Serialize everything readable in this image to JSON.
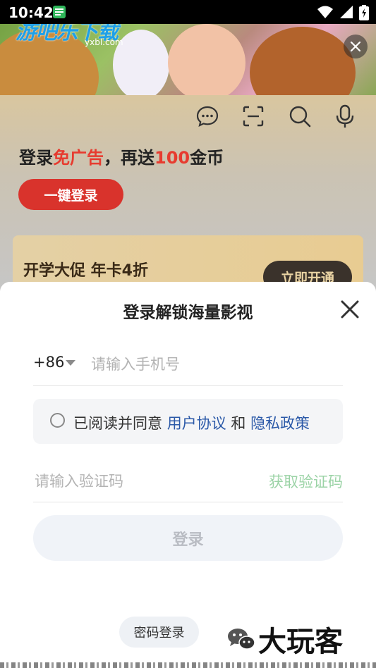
{
  "status_bar": {
    "time": "10:42",
    "icons": [
      "notification-icon",
      "wifi-icon",
      "signal-icon",
      "battery-icon"
    ]
  },
  "banner": {
    "watermark": "游吧乐下载",
    "watermark_sub": "yxbl.com",
    "close_icon": "close-icon"
  },
  "header_icons": [
    "message-icon",
    "scan-icon",
    "search-icon",
    "mic-icon"
  ],
  "promo": {
    "prefix": "登录",
    "highlight1": "免广告",
    "middle": "，再送",
    "highlight2": "100",
    "suffix": "金币",
    "login_button": "一键登录",
    "highlight_color": "#e73b2f"
  },
  "vip": {
    "title": "开学大促 年卡4折",
    "button": "立即开通"
  },
  "sheet": {
    "title": "登录解锁海量影视",
    "country_code": "+86",
    "phone_placeholder": "请输入手机号",
    "agreement_prefix": "已阅读并同意",
    "user_agreement": "用户协议",
    "and": "和",
    "privacy_policy": "隐私政策",
    "code_placeholder": "请输入验证码",
    "get_code": "获取验证码",
    "submit": "登录",
    "password_login": "密码登录"
  },
  "brand": {
    "text": "大玩客",
    "icon": "wechat-icon"
  }
}
